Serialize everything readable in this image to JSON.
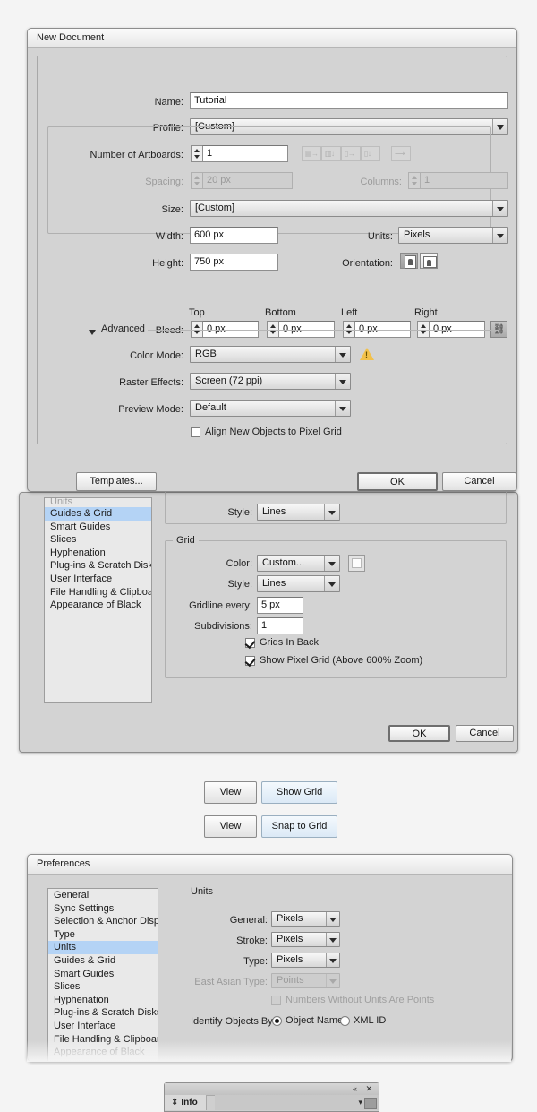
{
  "new_document": {
    "title": "New Document",
    "fields": {
      "name_label": "Name:",
      "name_value": "Tutorial",
      "profile_label": "Profile:",
      "profile_value": "[Custom]",
      "artboards_label": "Number of Artboards:",
      "artboards_value": "1",
      "spacing_label": "Spacing:",
      "spacing_value": "20 px",
      "columns_label": "Columns:",
      "columns_value": "1",
      "size_label": "Size:",
      "size_value": "[Custom]",
      "width_label": "Width:",
      "width_value": "600 px",
      "height_label": "Height:",
      "height_value": "750 px",
      "units_label": "Units:",
      "units_value": "Pixels",
      "orientation_label": "Orientation:",
      "bleed_label": "Bleed:",
      "bleed_top_label": "Top",
      "bleed_bottom_label": "Bottom",
      "bleed_left_label": "Left",
      "bleed_right_label": "Right",
      "bleed_top_value": "0 px",
      "bleed_bottom_value": "0 px",
      "bleed_left_value": "0 px",
      "bleed_right_value": "0 px"
    },
    "advanced": {
      "title": "Advanced",
      "color_mode_label": "Color Mode:",
      "color_mode_value": "RGB",
      "raster_label": "Raster Effects:",
      "raster_value": "Screen (72 ppi)",
      "preview_label": "Preview Mode:",
      "preview_value": "Default",
      "align_label": "Align New Objects to Pixel Grid"
    },
    "buttons": {
      "templates": "Templates...",
      "ok": "OK",
      "cancel": "Cancel"
    }
  },
  "prefs_grid": {
    "sidebar": [
      "Units",
      "Guides & Grid",
      "Smart Guides",
      "Slices",
      "Hyphenation",
      "Plug-ins & Scratch Disks",
      "User Interface",
      "File Handling & Clipboard",
      "Appearance of Black"
    ],
    "guides_style_label": "Style:",
    "guides_style_value": "Lines",
    "grid_group_title": "Grid",
    "color_label": "Color:",
    "color_value": "Custom...",
    "style_label": "Style:",
    "style_value": "Lines",
    "gridline_label": "Gridline every:",
    "gridline_value": "5 px",
    "subdivisions_label": "Subdivisions:",
    "subdivisions_value": "1",
    "grids_in_back": "Grids In Back",
    "show_pixel_grid": "Show Pixel Grid (Above 600% Zoom)",
    "ok": "OK",
    "cancel": "Cancel"
  },
  "menu_hints": [
    {
      "menu": "View",
      "item": "Show Grid"
    },
    {
      "menu": "View",
      "item": "Snap to Grid"
    }
  ],
  "prefs_units": {
    "title": "Preferences",
    "sidebar": [
      "General",
      "Sync Settings",
      "Selection & Anchor Display",
      "Type",
      "Units",
      "Guides & Grid",
      "Smart Guides",
      "Slices",
      "Hyphenation",
      "Plug-ins & Scratch Disks",
      "User Interface",
      "File Handling & Clipboard",
      "Appearance of Black"
    ],
    "section_title": "Units",
    "general_label": "General:",
    "general_value": "Pixels",
    "stroke_label": "Stroke:",
    "stroke_value": "Pixels",
    "type_label": "Type:",
    "type_value": "Pixels",
    "east_asian_label": "East Asian Type:",
    "east_asian_value": "Points",
    "numbers_label": "Numbers Without Units Are Points",
    "identify_label": "Identify Objects By:",
    "object_name": "Object Name",
    "xml_id": "XML ID"
  },
  "info_panel": {
    "tab": "Info",
    "collapse_icon": "«",
    "close_icon": "✕",
    "menu_icon": "▾"
  }
}
